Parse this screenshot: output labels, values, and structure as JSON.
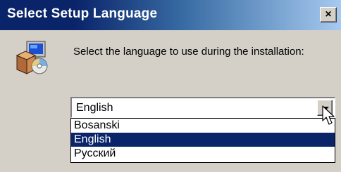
{
  "window": {
    "title": "Select Setup Language",
    "close_glyph": "×",
    "icon": "setup-installer-icon"
  },
  "prompt": "Select the language to use during the installation:",
  "language_select": {
    "value": "English",
    "button_icon": "chevron-down-icon",
    "options": [
      {
        "label": "Bosanski",
        "selected": false
      },
      {
        "label": "English",
        "selected": true
      },
      {
        "label": "Русский",
        "selected": false
      }
    ]
  },
  "colors": {
    "title_bar": "#0a246a",
    "title_bar_end": "#a6caf0",
    "dialog_face": "#d4d0c8",
    "selection": "#0a246a"
  }
}
